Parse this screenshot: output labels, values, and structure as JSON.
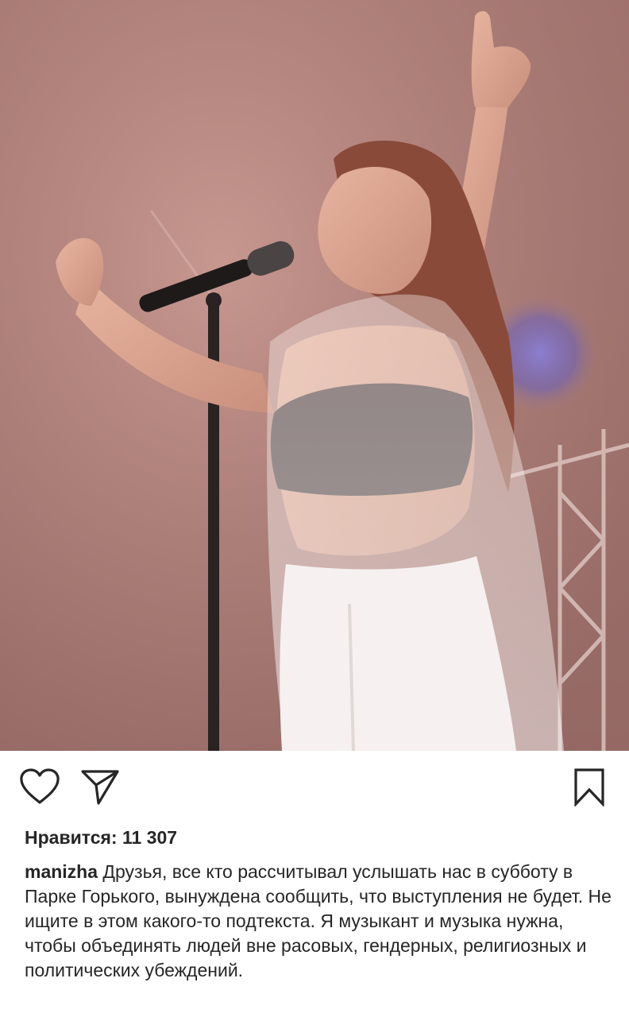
{
  "post": {
    "likes_label": "Нравится:",
    "likes_count": "11 307",
    "author": "manizha",
    "caption_text": "Друзья, все кто рассчитывал услышать нас в субботу в Парке Горького, вынуждена сообщить, что выступления не будет. Не ищите в этом какого-то подтекста. Я музыкант и музыка нужна, чтобы объединять людей вне расовых, гендерных, религиозных и политических убеждений."
  },
  "icons": {
    "like": "heart-icon",
    "share": "paper-plane-icon",
    "save": "bookmark-icon"
  },
  "colors": {
    "text": "#262626",
    "photo_tone": "#b08079"
  }
}
